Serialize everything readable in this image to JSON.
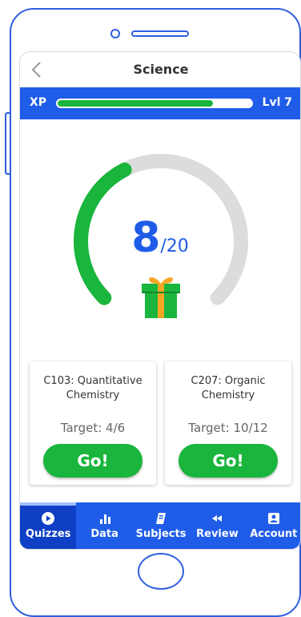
{
  "header": {
    "title": "Science"
  },
  "xp": {
    "label": "XP",
    "level": "Lvl 7",
    "progress": 0.8
  },
  "score": {
    "value": "8",
    "total": "/20",
    "fraction": 0.4
  },
  "cards": [
    {
      "title": "C103: Quantitative Chemistry",
      "target": "Target: 4/6",
      "button": "Go!"
    },
    {
      "title": "C207: Organic Chemistry",
      "target": "Target: 10/12",
      "button": "Go!"
    }
  ],
  "nav": [
    {
      "label": "Quizzes",
      "icon": "play-circle-icon",
      "active": true
    },
    {
      "label": "Data",
      "icon": "bar-chart-icon",
      "active": false
    },
    {
      "label": "Subjects",
      "icon": "book-icon",
      "active": false
    },
    {
      "label": "Review",
      "icon": "rewind-icon",
      "active": false
    },
    {
      "label": "Account",
      "icon": "account-icon",
      "active": false
    }
  ],
  "colors": {
    "accent": "#1f5ce8",
    "green": "#19b53c",
    "gauge_track": "#dcdcdc",
    "gift_box": "#19b53c",
    "gift_ribbon": "#f5a623"
  }
}
